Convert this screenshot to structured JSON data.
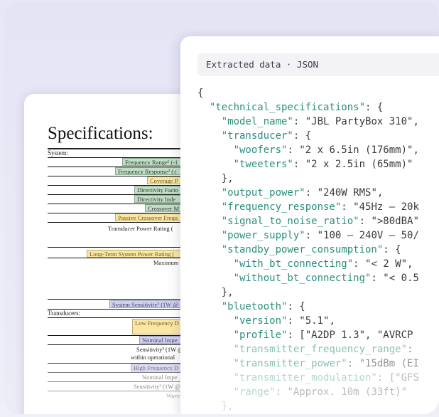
{
  "json_panel": {
    "header": "Extracted data · JSON",
    "lines": [
      {
        "indent": 0,
        "t": "{"
      },
      {
        "indent": 1,
        "k": "\"technical_specifications\"",
        "t": ": {"
      },
      {
        "indent": 2,
        "k": "\"model_name\"",
        "t": ": \"JBL PartyBox 310\","
      },
      {
        "indent": 2,
        "k": "\"transducer\"",
        "t": ": {"
      },
      {
        "indent": 3,
        "k": "\"woofers\"",
        "t": ": \"2 x 6.5in (176mm)\","
      },
      {
        "indent": 3,
        "k": "\"tweeters\"",
        "t": ": \"2 x 2.5in (65mm)\""
      },
      {
        "indent": 2,
        "t": "},"
      },
      {
        "indent": 2,
        "k": "\"output_power\"",
        "t": ": \"240W RMS\","
      },
      {
        "indent": 2,
        "k": "\"frequency_response\"",
        "t": ": \"45Hz – 20k"
      },
      {
        "indent": 2,
        "k": "\"signal_to_noise_ratio\"",
        "t": ": \">80dBA\""
      },
      {
        "indent": 2,
        "k": "\"power_supply\"",
        "t": ": \"100 – 240V – 50/"
      },
      {
        "indent": 2,
        "k": "\"standby_power_consumption\"",
        "t": ": {"
      },
      {
        "indent": 3,
        "k": "\"with_bt_connecting\"",
        "t": ": \"< 2 W\","
      },
      {
        "indent": 3,
        "k": "\"without_bt_connecting\"",
        "t": ": \"< 0.5"
      },
      {
        "indent": 2,
        "t": "},"
      },
      {
        "indent": 2,
        "k": "\"bluetooth\"",
        "t": ": {"
      },
      {
        "indent": 3,
        "k": "\"version\"",
        "t": ": \"5.1\","
      },
      {
        "indent": 3,
        "k": "\"profile\"",
        "t": ": [\"A2DP 1.3\", \"AVRCP"
      },
      {
        "indent": 3,
        "k": "\"transmitter_frequency_range\"",
        "t": ":",
        "fade": "A"
      },
      {
        "indent": 3,
        "k": "\"transmitter_power\"",
        "t": ": \"15dBm (EI",
        "fade": "A"
      },
      {
        "indent": 3,
        "k": "\"transmitter_modulation\"",
        "t": ": [\"GFS",
        "fade": "B"
      },
      {
        "indent": 3,
        "k": "\"range\"",
        "t": ": \"Approx. 10m (33ft)\"",
        "fade": "B"
      },
      {
        "indent": 2,
        "t": "},",
        "fade": "C"
      }
    ]
  },
  "document": {
    "title": "Specifications:",
    "system_label": "System:",
    "transducers_label": "Transducers:",
    "rows": {
      "freq_range": "Frequency Range¹ (-1",
      "freq_response": "Frequency Response² (±",
      "coverage": "Coverage P",
      "dir_factor": "Directivity Facto",
      "dir_index": "Directivity Inde",
      "crossover": "Crossover M",
      "passive_crossover": "Passive Crossover Frequ",
      "transducer_power": "Transducer Power Rating (",
      "long_term": "Long-Term System Power Rating (",
      "maximum": "Maximum",
      "sensitivity": "System Sensitivity³ (1W @",
      "low_freq": "Low Frequency D",
      "nominal_imp": "Nominal Impe",
      "sensitivity2": "Sensitivity³ (1W @",
      "within_op": "within operational",
      "high_freq": "High Frequency D",
      "nominal_imp2": "Nominal Impe",
      "sensitivity3": "Sensitivity³ (1W @",
      "wave": "Wave"
    }
  }
}
